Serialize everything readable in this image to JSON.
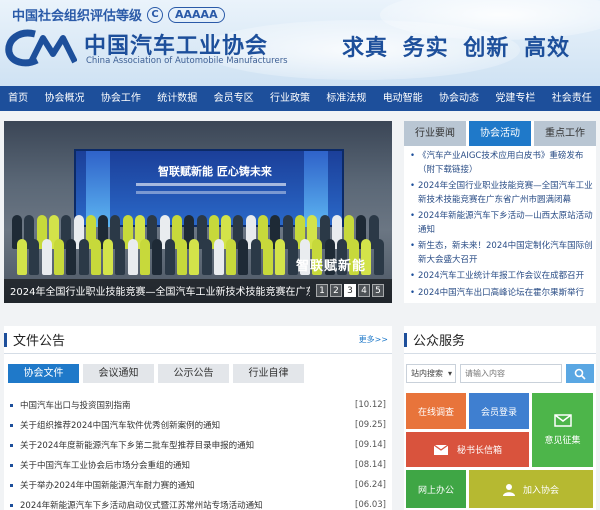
{
  "header": {
    "rating_text": "中国社会组织评估等级",
    "rating_symbol": "C",
    "rating_stars": "AAAAA",
    "org_name_cn": "中国汽车工业协会",
    "org_name_en": "China Association of Automobile Manufacturers",
    "motto": "求真 务实 创新 高效"
  },
  "nav": {
    "items": [
      "首页",
      "协会概况",
      "协会工作",
      "统计数据",
      "会员专区",
      "行业政策",
      "标准法规",
      "电动智能",
      "协会动态",
      "党建专栏",
      "社会责任"
    ]
  },
  "carousel": {
    "caption": "2024年全国行业职业技能竞赛—全国汽车工业新技术技能竞赛在广东省广州市圆满闭幕",
    "screen_text": "智联赋新能 匠心铸未来",
    "overlay_brand": "智联赋新能",
    "slides": [
      "1",
      "2",
      "3",
      "4",
      "5"
    ],
    "active_slide": "3"
  },
  "news": {
    "tabs": [
      "行业要闻",
      "协会活动",
      "重点工作"
    ],
    "active_tab": "协会活动",
    "items": [
      "《汽车产业AIGC技术应用白皮书》重磅发布（附下载链接）",
      "2024年全国行业职业技能竞赛—全国汽车工业新技术技能竞赛在广东省广州市圆满闭幕",
      "2024年新能源汽车下乡活动—山西太原站活动通知",
      "新生态，新未来！2024中国定制化汽车国际创新大会盛大召开",
      "2024汽车工业统计年报工作会议在成都召开",
      "2024中国汽车出口高峰论坛在霍尔果斯举行"
    ]
  },
  "files": {
    "title": "文件公告",
    "more": "更多>>",
    "tabs": [
      "协会文件",
      "会议通知",
      "公示公告",
      "行业自律"
    ],
    "active_tab": "协会文件",
    "rows": [
      {
        "title": "中国汽车出口与投资国别指南",
        "date": "[10.12]"
      },
      {
        "title": "关于组织推荐2024中国汽车软件优秀创新案例的通知",
        "date": "[09.25]"
      },
      {
        "title": "关于2024年度新能源汽车下乡第二批车型推荐目录申报的通知",
        "date": "[09.14]"
      },
      {
        "title": "关于中国汽车工业协会后市场分会重组的通知",
        "date": "[08.14]"
      },
      {
        "title": "关于举办2024年中国新能源汽车耐力赛的通知",
        "date": "[06.24]"
      },
      {
        "title": "2024年新能源汽车下乡活动启动仪式暨江苏常州站专场活动通知",
        "date": "[06.03]"
      }
    ]
  },
  "services": {
    "title": "公众服务",
    "search_scope": "站内搜索",
    "search_placeholder": "请输入内容",
    "tiles": {
      "online_survey": "在线调查",
      "member_login": "会员登录",
      "opinion_collection": "意见征集",
      "secretary_mailbox": "秘书长信箱",
      "online_office": "网上办公",
      "join_association": "加入协会"
    },
    "colors": {
      "orange": "#e8743b",
      "blue": "#3f7fd0",
      "green": "#4db54a",
      "red": "#d9533d",
      "olive": "#b6b931",
      "green2": "#3fa645"
    }
  },
  "colors": {
    "brand_blue": "#1d4f9b",
    "accent_blue": "#1f79c9"
  }
}
